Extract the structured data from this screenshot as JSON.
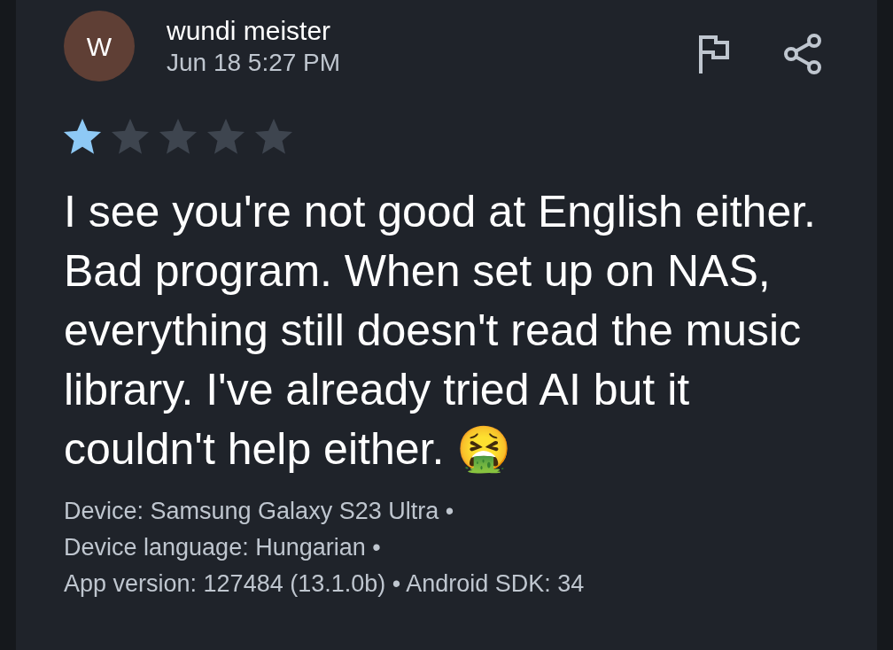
{
  "review": {
    "avatar_letter": "W",
    "author": "wundi meister",
    "date": "Jun 18 5:27 PM",
    "stars": 1,
    "text": "I see you're not good at English either. Bad program. When set up on NAS, everything still doesn't read the music library. I've already tried AI but it couldn't help either. 🤮",
    "details": [
      "Device: Samsung Galaxy S23 Ultra •",
      "Device language: Hungarian •",
      "App version: 127484 (13.1.0b) • Android SDK: 34"
    ]
  }
}
